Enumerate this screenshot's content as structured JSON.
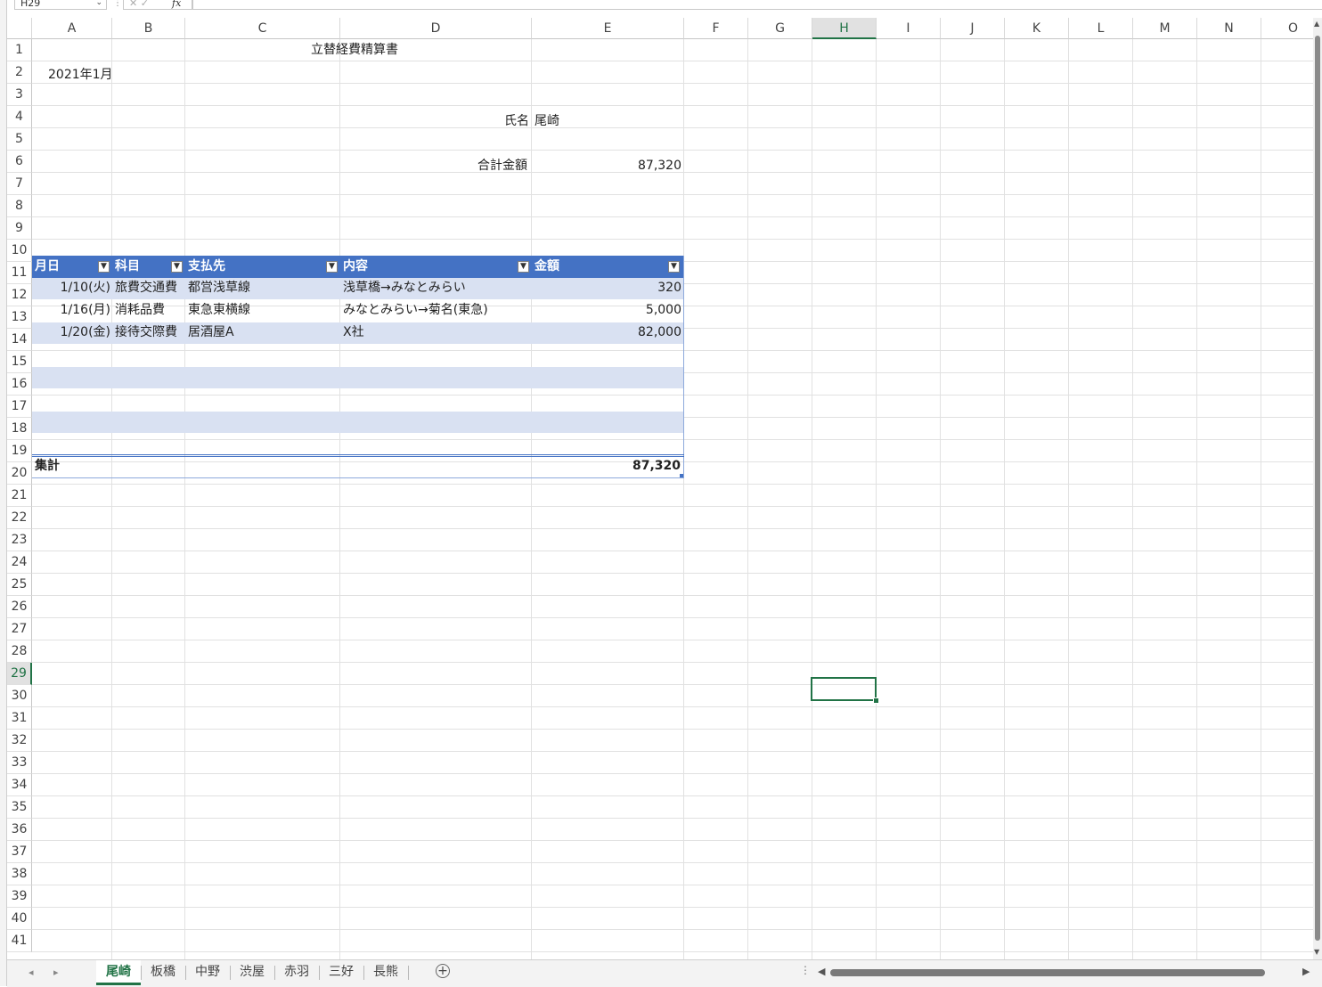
{
  "formula_bar": {
    "name_box": "H29",
    "fx_label": "fx",
    "cancel_enter": "✕ ✓",
    "formula": ""
  },
  "columns": [
    "A",
    "B",
    "C",
    "D",
    "E",
    "F",
    "G",
    "H",
    "I",
    "J",
    "K",
    "L",
    "M",
    "N",
    "O"
  ],
  "selected_column": "H",
  "rows": [
    "1",
    "2",
    "3",
    "4",
    "5",
    "6",
    "7",
    "8",
    "9",
    "10",
    "11",
    "12",
    "13",
    "14",
    "15",
    "16",
    "17",
    "18",
    "19",
    "20",
    "21",
    "22",
    "23",
    "24",
    "25",
    "26",
    "27",
    "28",
    "29",
    "30",
    "31",
    "32",
    "33",
    "34",
    "35",
    "36",
    "37",
    "38",
    "39",
    "40",
    "41"
  ],
  "selected_row": "29",
  "sheet": {
    "title": "立替経費精算書",
    "period": "2021年1月",
    "name_label": "氏名",
    "name_value": "尾崎",
    "total_label": "合計金額",
    "total_value": "87,320"
  },
  "table": {
    "headers": [
      "月日",
      "科目",
      "支払先",
      "内容",
      "金額"
    ],
    "rows": [
      {
        "date": "1/10(火)",
        "category": "旅費交通費",
        "payee": "都営浅草線",
        "content": "浅草橋→みなとみらい",
        "amount": "320"
      },
      {
        "date": "1/16(月)",
        "category": "消耗品費",
        "payee": "東急東横線",
        "content": "みなとみらい→菊名(東急)",
        "amount": "5,000"
      },
      {
        "date": "1/20(金)",
        "category": "接待交際費",
        "payee": "居酒屋A",
        "content": "X社",
        "amount": "82,000"
      }
    ],
    "total_label": "集計",
    "total_value": "87,320"
  },
  "sheet_tabs": [
    "尾崎",
    "板橋",
    "中野",
    "渋屋",
    "赤羽",
    "三好",
    "長熊"
  ],
  "active_tab": "尾崎",
  "accent_color": "#217346",
  "table_header_color": "#4472c4",
  "table_band_color": "#d9e1f2"
}
